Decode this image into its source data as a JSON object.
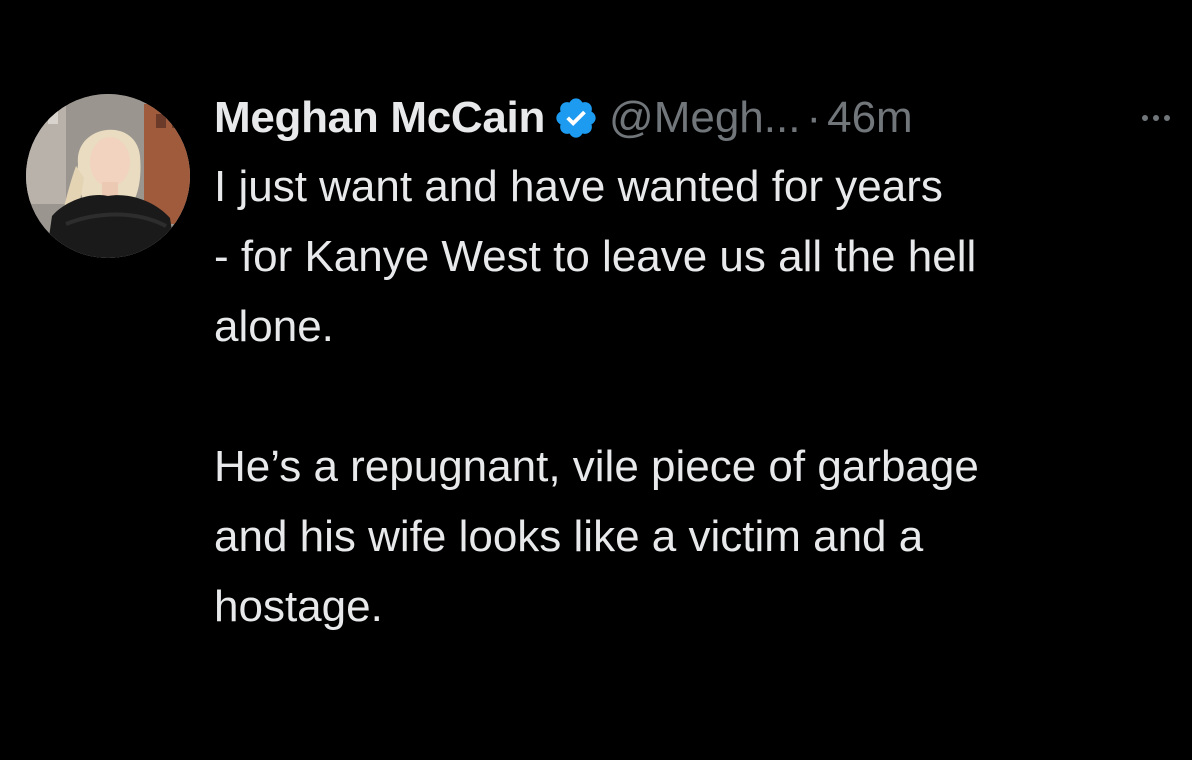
{
  "tweet": {
    "author": {
      "name": "Meghan McCain",
      "handle": "@Megh...",
      "separator": "·",
      "time": "46m",
      "verified_icon": "verified-badge-icon",
      "verified_color": "#1d9bf0"
    },
    "more_icon": "more-horizontal-icon",
    "body": {
      "paragraph_1": [
        "I just want and have wanted for years",
        "- for Kanye West to leave us all the hell",
        "alone."
      ],
      "paragraph_2": [
        "He’s a repugnant, vile piece of garbage",
        "and his wife looks like a victim and a",
        "hostage."
      ]
    }
  },
  "colors": {
    "background": "#000000",
    "primary_text": "#e7e9ea",
    "secondary_text": "#71767b",
    "accent": "#1d9bf0"
  }
}
